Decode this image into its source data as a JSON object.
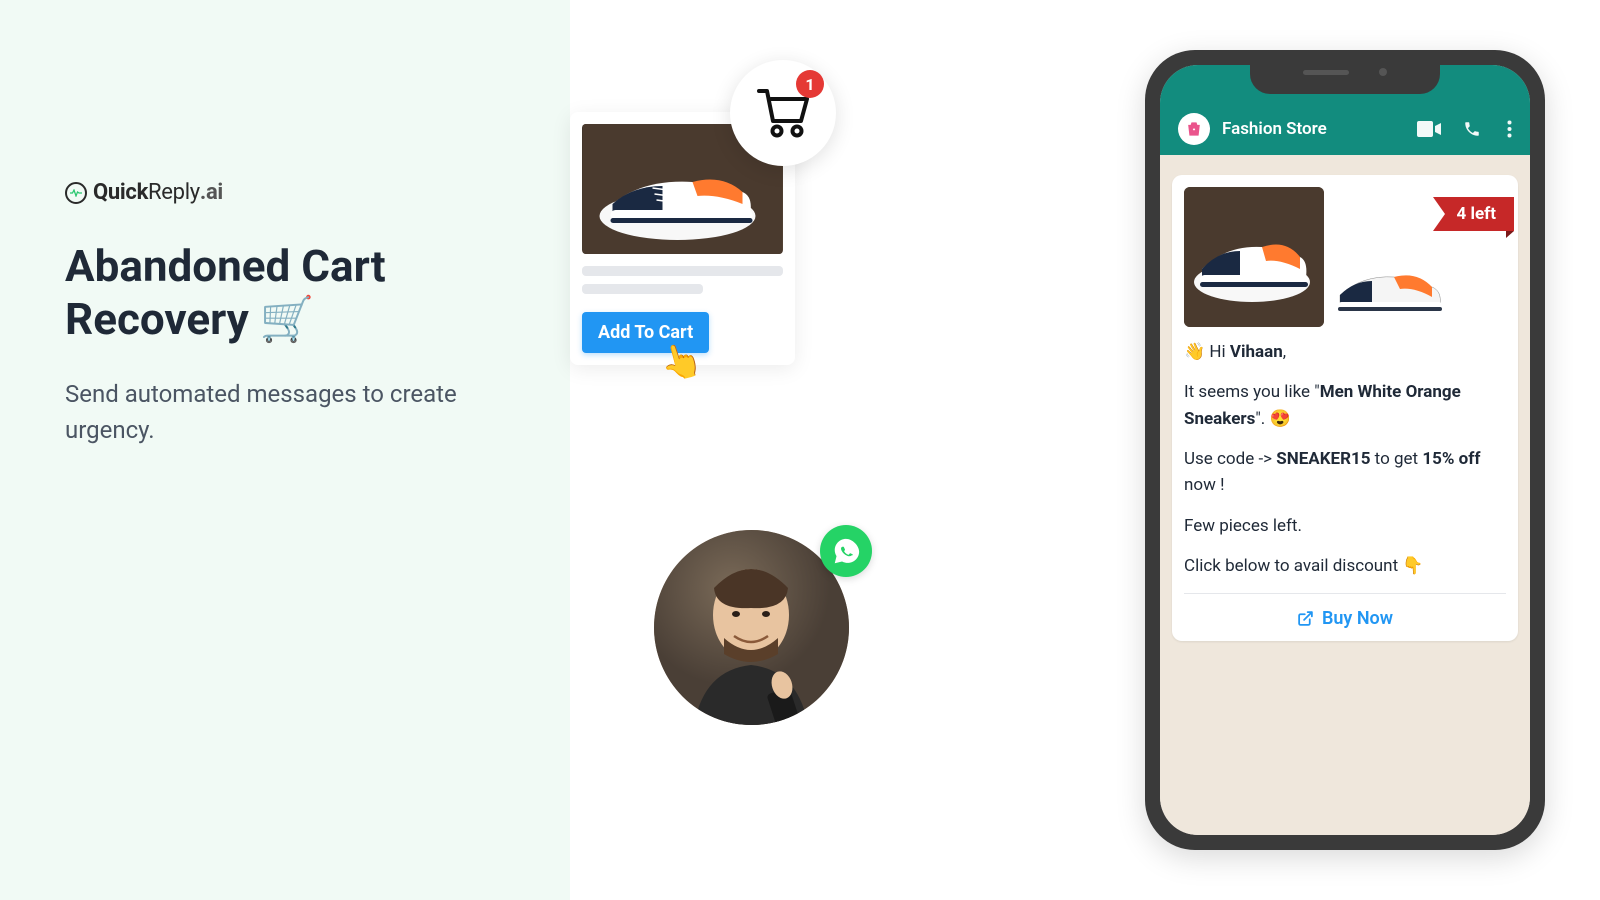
{
  "brand": {
    "name_quick": "Quick",
    "name_reply": "Reply",
    "name_ai": ".ai"
  },
  "headline": "Abandoned Cart Recovery 🛒",
  "subline": "Send automated messages to create urgency.",
  "product_card": {
    "add_to_cart": "Add To Cart",
    "cart_count": "1"
  },
  "whatsapp": {
    "store_name": "Fashion Store",
    "stock_label": "4 left",
    "greeting_wave": "👋 ",
    "greeting_hi": "Hi ",
    "customer_name": "Vihaan",
    "greeting_comma": ",",
    "line2_pre": "It seems you like \"",
    "product_name": "Men White Orange Sneakers",
    "line2_post": "\". 😍",
    "line3_pre": "Use code -> ",
    "code": "SNEAKER15",
    "line3_mid": " to get ",
    "discount": "15% off",
    "line3_post": " now !",
    "line4": "Few pieces left.",
    "line5": "Click below to avail discount 👇",
    "buy_now": "Buy Now"
  }
}
